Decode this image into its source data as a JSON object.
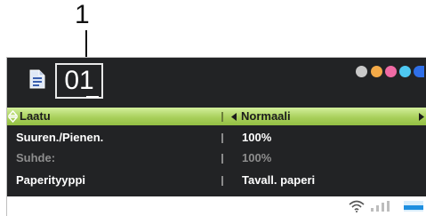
{
  "callout": {
    "number": "1"
  },
  "header": {
    "copies": "01",
    "ink_colors": [
      "#c9c9c9",
      "#f4aa48",
      "#f06aa4",
      "#4ec8f2",
      "#2f6fe8"
    ]
  },
  "menu": {
    "rows": [
      {
        "label": "Laatu",
        "value": "Normaali"
      },
      {
        "label": "Suuren./Pienen.",
        "value": "100%"
      },
      {
        "label": "Suhde:",
        "value": "100%"
      },
      {
        "label": "Paperityyppi",
        "value": "Tavall. paperi"
      }
    ]
  },
  "colors": {
    "highlight": "#a9d05c",
    "screen": "#222325"
  }
}
